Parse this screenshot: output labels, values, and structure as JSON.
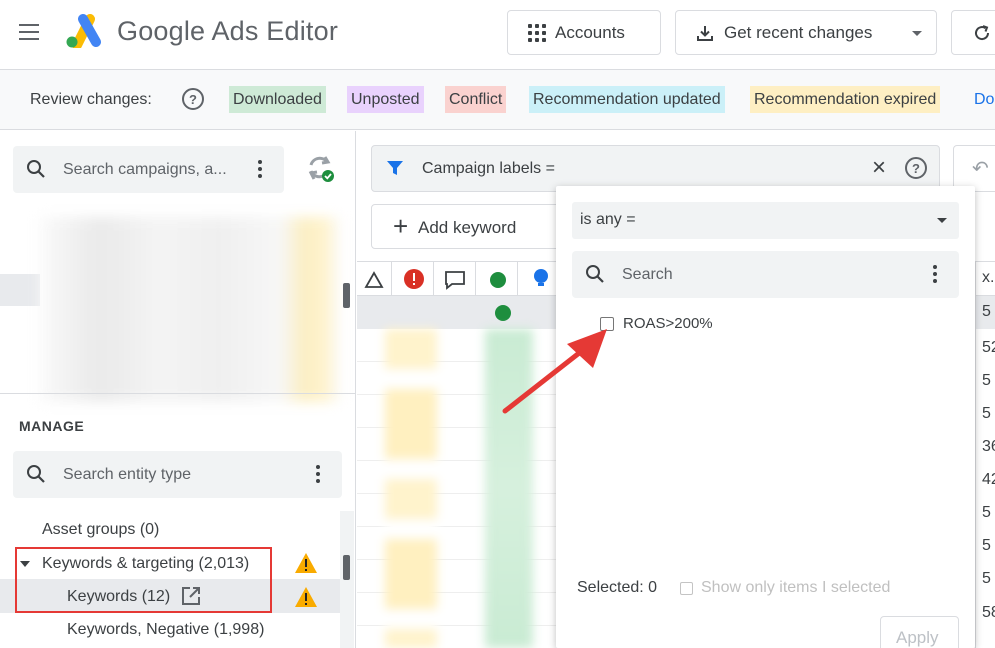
{
  "header": {
    "app_title": "Google Ads Editor",
    "accounts_label": "Accounts",
    "get_changes_label": "Get recent changes"
  },
  "review_bar": {
    "label": "Review changes:",
    "chips": [
      "Downloaded",
      "Unposted",
      "Conflict",
      "Recommendation updated",
      "Recommendation expired"
    ],
    "more_label": "Do"
  },
  "left_panel": {
    "campaign_search_placeholder": "Search campaigns, a...",
    "manage_label": "MANAGE",
    "entity_search_placeholder": "Search entity type",
    "tree": {
      "asset_groups": "Asset groups (0)",
      "keywords_targeting": "Keywords & targeting (2,013)",
      "keywords": "Keywords (12)",
      "keywords_negative": "Keywords, Negative (1,998)"
    }
  },
  "main": {
    "filter_text": "Campaign labels =",
    "add_keyword_label": "Add keyword",
    "right_column_header": "x. C",
    "right_column_values": [
      "5",
      "52",
      "5",
      "5",
      "36",
      "42",
      "5",
      "5",
      "5",
      "58"
    ]
  },
  "dropdown": {
    "operator_label": "is any   =",
    "search_placeholder": "Search",
    "options": [
      "ROAS>200%"
    ],
    "selected_label": "Selected: 0",
    "show_only_label": "Show only items I selected",
    "apply_label": "Apply"
  },
  "colors": {
    "accent": "#1a73e8",
    "annotation_red": "#e53935",
    "downloaded": "#ceead6",
    "unposted": "#e9d2fd",
    "conflict": "#fad2cf",
    "rec_updated": "#cbf0f8",
    "rec_expired": "#feefc3"
  }
}
